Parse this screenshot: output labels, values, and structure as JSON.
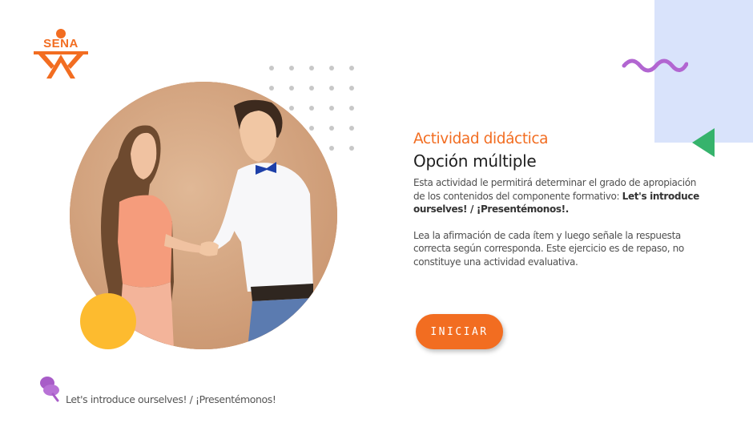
{
  "logo": {
    "text": "SENA",
    "color": "#f26d21"
  },
  "content": {
    "kicker": "Actividad didáctica",
    "title": "Opción múltiple",
    "paragraph1_text": "Esta actividad le permitirá determinar el grado de apropiación de los contenidos del componente formativo:",
    "paragraph1_bold": "Let's introduce ourselves! / ¡Presentémonos!.",
    "paragraph2": "Lea la afirmación de cada ítem y luego señale la respuesta correcta según corresponda. Este ejercicio es de repaso, no constituye una actividad evaluativa."
  },
  "button": {
    "label": "INICIAR",
    "color": "#f26d21"
  },
  "footer": {
    "text": "Let's introduce ourselves! / ¡Presentémonos!",
    "icon": "pin-icon"
  },
  "colors": {
    "accent": "#f26d21",
    "light_panel": "#d9e3fb",
    "yellow": "#fdbb2f",
    "wave": "#b266d1",
    "triangle": "#36b36c"
  },
  "decorations": [
    "dot-grid",
    "purple-wave",
    "green-triangle",
    "yellow-circle"
  ]
}
